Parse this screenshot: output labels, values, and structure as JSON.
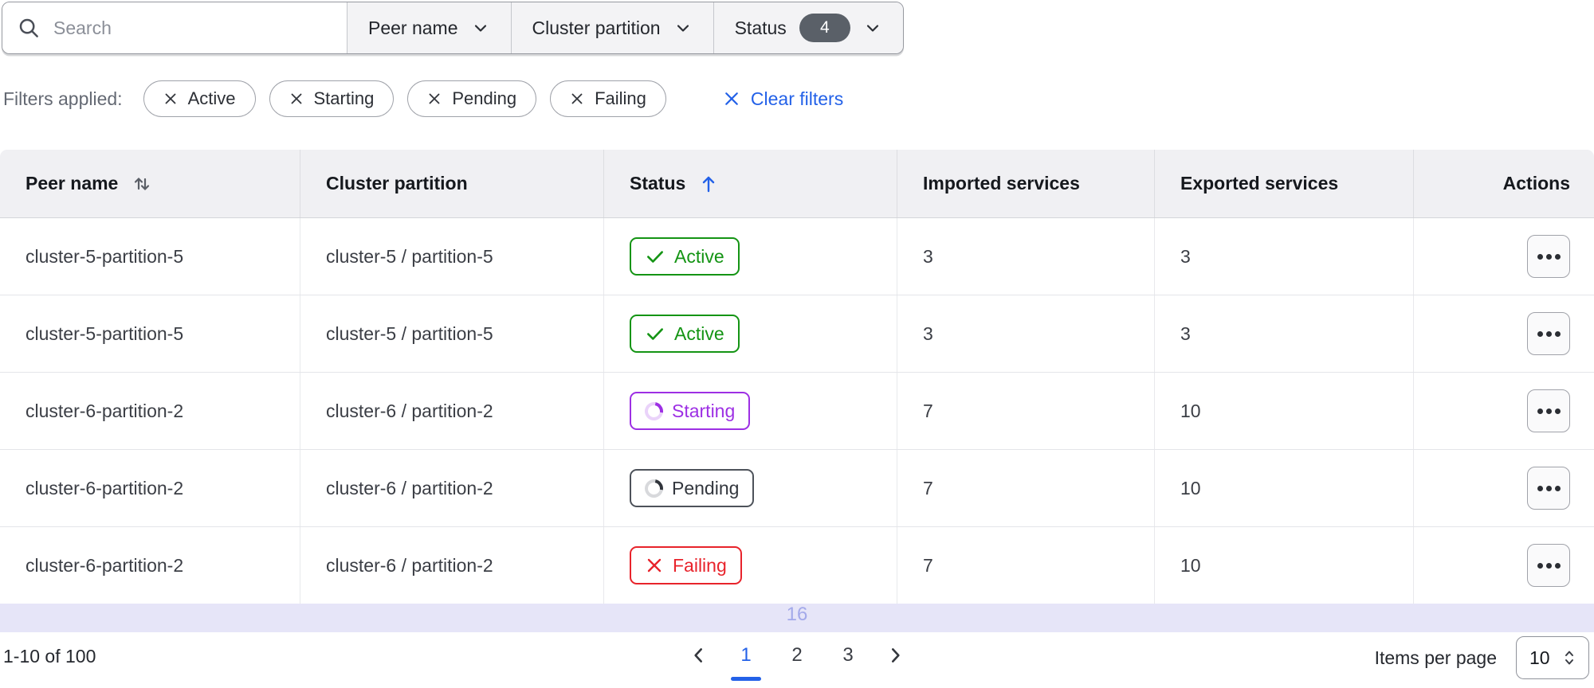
{
  "filter_bar": {
    "search": {
      "placeholder": "Search"
    },
    "dropdowns": [
      {
        "label": "Peer name"
      },
      {
        "label": "Cluster partition"
      },
      {
        "label": "Status",
        "count": "4"
      }
    ]
  },
  "applied_filters": {
    "label": "Filters applied:",
    "chips": [
      "Active",
      "Starting",
      "Pending",
      "Failing"
    ],
    "clear_label": "Clear filters"
  },
  "table": {
    "columns": [
      {
        "label": "Peer name",
        "sort": "both"
      },
      {
        "label": "Cluster partition",
        "sort": "none"
      },
      {
        "label": "Status",
        "sort": "asc"
      },
      {
        "label": "Imported services",
        "sort": "none"
      },
      {
        "label": "Exported services",
        "sort": "none"
      },
      {
        "label": "Actions",
        "sort": "none"
      }
    ],
    "rows": [
      {
        "peer": "cluster-5-partition-5",
        "partition": "cluster-5 / partition-5",
        "status": "Active",
        "status_kind": "active",
        "imported": "3",
        "exported": "3"
      },
      {
        "peer": "cluster-5-partition-5",
        "partition": "cluster-5 / partition-5",
        "status": "Active",
        "status_kind": "active",
        "imported": "3",
        "exported": "3"
      },
      {
        "peer": "cluster-6-partition-2",
        "partition": "cluster-6 / partition-2",
        "status": "Starting",
        "status_kind": "starting",
        "imported": "7",
        "exported": "10"
      },
      {
        "peer": "cluster-6-partition-2",
        "partition": "cluster-6 / partition-2",
        "status": "Pending",
        "status_kind": "pending",
        "imported": "7",
        "exported": "10"
      },
      {
        "peer": "cluster-6-partition-2",
        "partition": "cluster-6 / partition-2",
        "status": "Failing",
        "status_kind": "failing",
        "imported": "7",
        "exported": "10"
      }
    ],
    "partial_row_text": "16"
  },
  "pagination": {
    "range_label": "1-10 of 100",
    "pages": [
      "1",
      "2",
      "3"
    ],
    "active_page": "1",
    "items_per_page_label": "Items per page",
    "items_per_page_value": "10"
  },
  "colors": {
    "accent_blue": "#2361e8",
    "success_green": "#149414",
    "starting_purple": "#9d2fe4",
    "pending_gray": "#4d525a",
    "failing_red": "#e8232b",
    "selected_row_lavender": "#e6e5f8"
  }
}
